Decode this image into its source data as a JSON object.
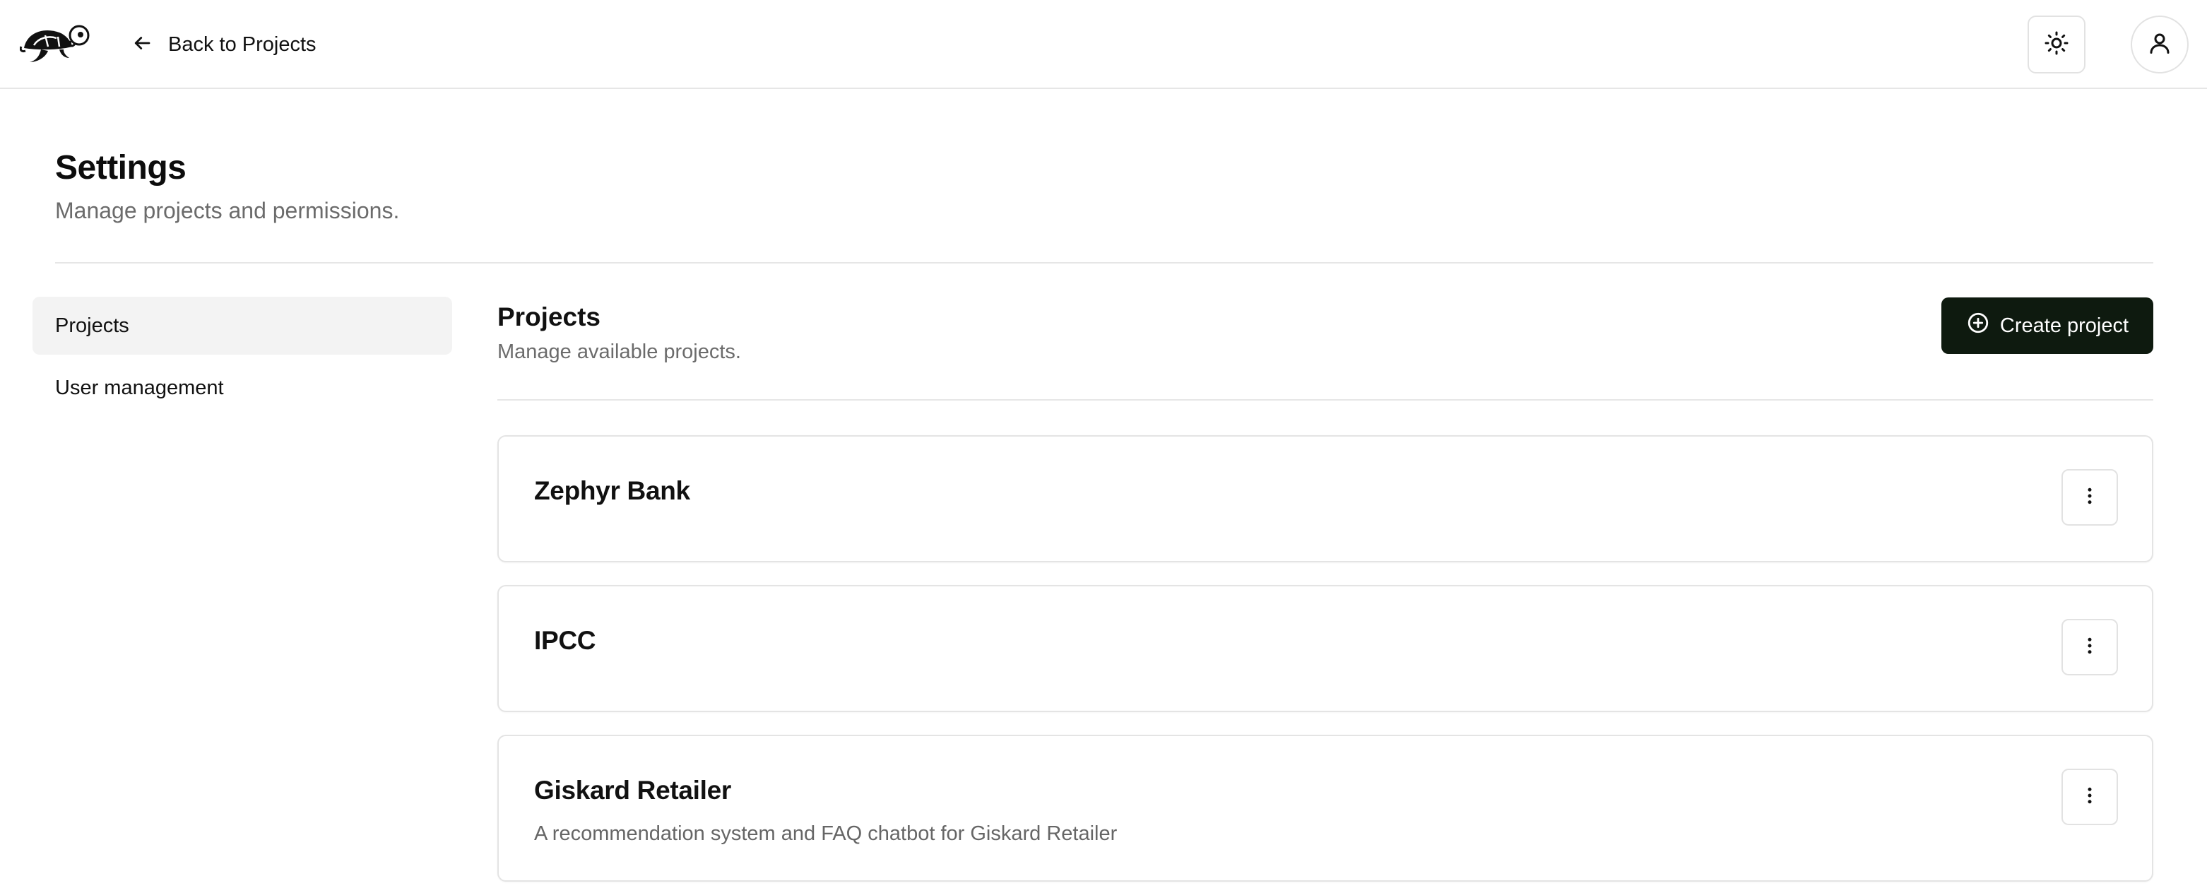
{
  "header": {
    "logo_icon": "turtle-logo",
    "back_label": "Back to Projects",
    "back_icon": "arrow-left-icon",
    "theme_icon": "sun-icon",
    "user_icon": "user-icon"
  },
  "page": {
    "title": "Settings",
    "subtitle": "Manage projects and permissions."
  },
  "sidebar": {
    "items": [
      {
        "label": "Projects",
        "active": true
      },
      {
        "label": "User management",
        "active": false
      }
    ]
  },
  "main": {
    "title": "Projects",
    "subtitle": "Manage available projects.",
    "create_label": "Create project",
    "create_icon": "plus-circle-icon",
    "accent": "#0e1a0f",
    "projects": [
      {
        "name": "Zephyr Bank",
        "description": ""
      },
      {
        "name": "IPCC",
        "description": ""
      },
      {
        "name": "Giskard Retailer",
        "description": "A recommendation system and FAQ chatbot for Giskard Retailer"
      }
    ]
  }
}
